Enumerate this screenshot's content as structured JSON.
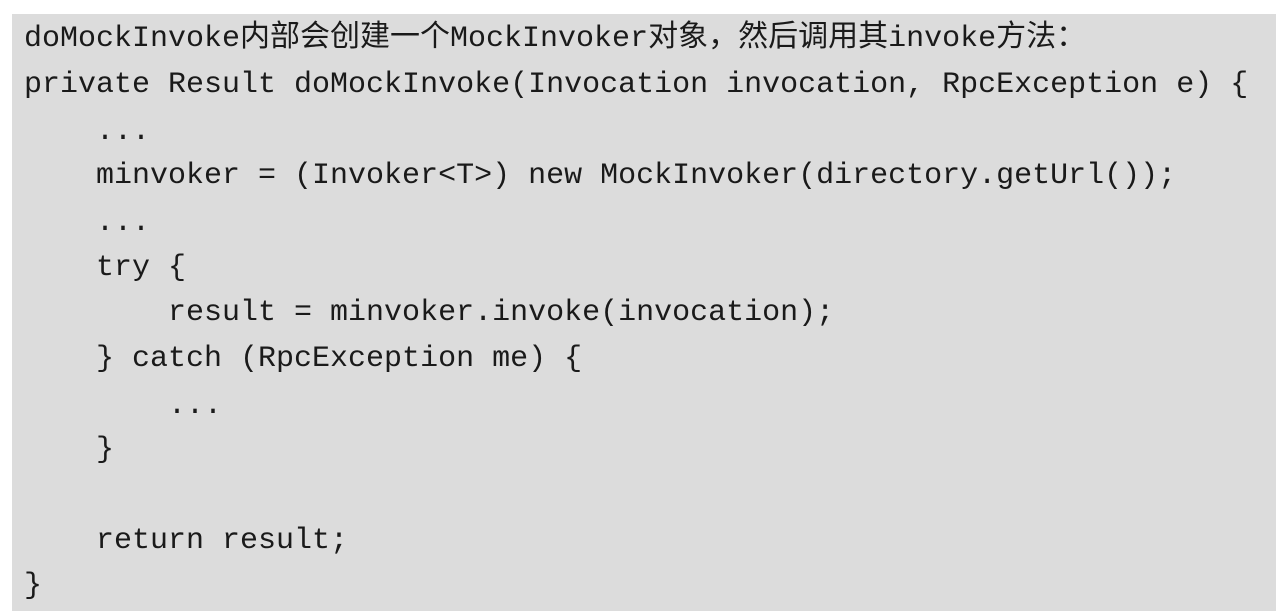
{
  "intro": "doMockInvoke内部会创建一个MockInvoker对象，然后调用其invoke方法：",
  "code_lines": [
    "private Result doMockInvoke(Invocation invocation, RpcException e) {",
    "    ...",
    "    minvoker = (Invoker<T>) new MockInvoker(directory.getUrl());",
    "    ...",
    "    try {",
    "        result = minvoker.invoke(invocation);",
    "    } catch (RpcException me) {",
    "        ...",
    "    }",
    "",
    "    return result;",
    "}"
  ]
}
